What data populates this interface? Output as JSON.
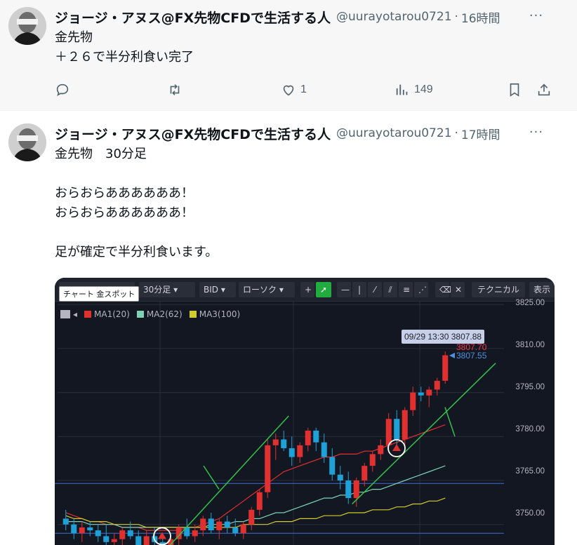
{
  "tweets": [
    {
      "author_name": "ジョージ・アヌス@FX先物CFDで生活する人",
      "handle": "@uurayotarou0721",
      "separator": "·",
      "time": "16時間",
      "more": "···",
      "text": "金先物\n＋２６で半分利食い完了",
      "actions": {
        "reply_count": "",
        "retweet_count": "",
        "like_count": "1",
        "view_count": "149"
      }
    },
    {
      "author_name": "ジョージ・アヌス@FX先物CFDで生活する人",
      "handle": "@uurayotarou0721",
      "separator": "·",
      "time": "17時間",
      "more": "···",
      "text": "金先物　30分足\n\nおらおらああああああ！\nおらおらああああああ！\n\n足が確定で半分利食います。"
    }
  ],
  "chart": {
    "tooltip": "チャート 金スポット",
    "toolbar": {
      "timeframe": "30分足",
      "price_type": "BID",
      "chart_style": "ローソク",
      "technical": "テクニカル",
      "display": "表示"
    },
    "legend": [
      {
        "label": "MA1(20)",
        "color": "#e0302f"
      },
      {
        "label": "MA2(62)",
        "color": "#7fd3b4"
      },
      {
        "label": "MA3(100)",
        "color": "#d3cb2e"
      }
    ],
    "price_labels": [
      "3825.00",
      "3810.00",
      "3795.00",
      "3780.00",
      "3765.00",
      "3750.00"
    ],
    "crosshair_tooltip": "09/29 13:30 3807.88",
    "current_price_red": "3807.70",
    "current_price_blue": "3807.55"
  },
  "chart_data": {
    "type": "candlestick",
    "title": "",
    "ylim": [
      3743,
      3826
    ],
    "y_ticks": [
      3825.0,
      3810.0,
      3795.0,
      3780.0,
      3765.0,
      3750.0
    ],
    "candles": [
      {
        "o": 3752,
        "h": 3755,
        "l": 3748,
        "c": 3750
      },
      {
        "o": 3750,
        "h": 3752,
        "l": 3745,
        "c": 3747
      },
      {
        "o": 3747,
        "h": 3751,
        "l": 3744,
        "c": 3749
      },
      {
        "o": 3749,
        "h": 3751,
        "l": 3746,
        "c": 3748
      },
      {
        "o": 3748,
        "h": 3750,
        "l": 3744,
        "c": 3746
      },
      {
        "o": 3746,
        "h": 3750,
        "l": 3743,
        "c": 3744
      },
      {
        "o": 3744,
        "h": 3747,
        "l": 3742,
        "c": 3745
      },
      {
        "o": 3745,
        "h": 3749,
        "l": 3743,
        "c": 3748
      },
      {
        "o": 3748,
        "h": 3751,
        "l": 3745,
        "c": 3746
      },
      {
        "o": 3746,
        "h": 3748,
        "l": 3741,
        "c": 3743
      },
      {
        "o": 3743,
        "h": 3748,
        "l": 3740,
        "c": 3746
      },
      {
        "o": 3746,
        "h": 3749,
        "l": 3742,
        "c": 3744
      },
      {
        "o": 3744,
        "h": 3746,
        "l": 3740,
        "c": 3742
      },
      {
        "o": 3742,
        "h": 3746,
        "l": 3740,
        "c": 3745
      },
      {
        "o": 3745,
        "h": 3750,
        "l": 3743,
        "c": 3749
      },
      {
        "o": 3749,
        "h": 3752,
        "l": 3745,
        "c": 3746
      },
      {
        "o": 3746,
        "h": 3750,
        "l": 3744,
        "c": 3748
      },
      {
        "o": 3748,
        "h": 3753,
        "l": 3746,
        "c": 3752
      },
      {
        "o": 3752,
        "h": 3754,
        "l": 3747,
        "c": 3748
      },
      {
        "o": 3748,
        "h": 3752,
        "l": 3745,
        "c": 3751
      },
      {
        "o": 3751,
        "h": 3753,
        "l": 3747,
        "c": 3749
      },
      {
        "o": 3749,
        "h": 3752,
        "l": 3746,
        "c": 3747
      },
      {
        "o": 3747,
        "h": 3751,
        "l": 3745,
        "c": 3750
      },
      {
        "o": 3750,
        "h": 3756,
        "l": 3748,
        "c": 3755
      },
      {
        "o": 3755,
        "h": 3762,
        "l": 3753,
        "c": 3761
      },
      {
        "o": 3761,
        "h": 3779,
        "l": 3759,
        "c": 3777
      },
      {
        "o": 3777,
        "h": 3781,
        "l": 3772,
        "c": 3779
      },
      {
        "o": 3779,
        "h": 3782,
        "l": 3775,
        "c": 3776
      },
      {
        "o": 3776,
        "h": 3780,
        "l": 3770,
        "c": 3773
      },
      {
        "o": 3773,
        "h": 3778,
        "l": 3771,
        "c": 3777
      },
      {
        "o": 3777,
        "h": 3783,
        "l": 3775,
        "c": 3782
      },
      {
        "o": 3782,
        "h": 3783,
        "l": 3775,
        "c": 3778
      },
      {
        "o": 3778,
        "h": 3781,
        "l": 3771,
        "c": 3773
      },
      {
        "o": 3773,
        "h": 3776,
        "l": 3765,
        "c": 3767
      },
      {
        "o": 3767,
        "h": 3770,
        "l": 3762,
        "c": 3765
      },
      {
        "o": 3765,
        "h": 3768,
        "l": 3757,
        "c": 3759
      },
      {
        "o": 3759,
        "h": 3766,
        "l": 3756,
        "c": 3765
      },
      {
        "o": 3765,
        "h": 3771,
        "l": 3763,
        "c": 3770
      },
      {
        "o": 3770,
        "h": 3775,
        "l": 3768,
        "c": 3774
      },
      {
        "o": 3774,
        "h": 3779,
        "l": 3772,
        "c": 3777
      },
      {
        "o": 3777,
        "h": 3788,
        "l": 3775,
        "c": 3786
      },
      {
        "o": 3786,
        "h": 3789,
        "l": 3777,
        "c": 3779
      },
      {
        "o": 3779,
        "h": 3790,
        "l": 3776,
        "c": 3789
      },
      {
        "o": 3789,
        "h": 3797,
        "l": 3787,
        "c": 3795
      },
      {
        "o": 3795,
        "h": 3797,
        "l": 3792,
        "c": 3794
      },
      {
        "o": 3794,
        "h": 3797,
        "l": 3790,
        "c": 3796
      },
      {
        "o": 3796,
        "h": 3800,
        "l": 3794,
        "c": 3799
      },
      {
        "o": 3799,
        "h": 3809,
        "l": 3798,
        "c": 3807.7
      }
    ],
    "series": [
      {
        "name": "MA1(20)",
        "color": "#e0302f",
        "values": [
          3754,
          3753,
          3752,
          3751,
          3751,
          3750,
          3750,
          3749,
          3749,
          3749,
          3748,
          3748,
          3748,
          3748,
          3748,
          3749,
          3749,
          3750,
          3751,
          3752,
          3754,
          3756,
          3758,
          3760,
          3762,
          3764,
          3766,
          3768,
          3769,
          3770,
          3771,
          3772,
          3773,
          3773,
          3774,
          3774,
          3774,
          3775,
          3775,
          3776,
          3777,
          3778,
          3779,
          3780,
          3781,
          3782,
          3783,
          3784
        ]
      },
      {
        "name": "MA2(62)",
        "color": "#7fd3b4",
        "values": [
          3751,
          3751,
          3751,
          3750,
          3750,
          3750,
          3750,
          3749,
          3749,
          3749,
          3749,
          3749,
          3749,
          3749,
          3749,
          3749,
          3749,
          3749,
          3750,
          3750,
          3750,
          3751,
          3751,
          3752,
          3752,
          3753,
          3754,
          3754,
          3755,
          3756,
          3757,
          3758,
          3759,
          3759,
          3760,
          3760,
          3761,
          3761,
          3762,
          3762,
          3763,
          3764,
          3765,
          3766,
          3767,
          3768,
          3769,
          3770
        ]
      },
      {
        "name": "MA3(100)",
        "color": "#d3cb2e",
        "values": [
          3753,
          3752,
          3752,
          3751,
          3751,
          3751,
          3750,
          3750,
          3750,
          3750,
          3749,
          3749,
          3749,
          3749,
          3749,
          3749,
          3749,
          3749,
          3749,
          3749,
          3749,
          3749,
          3750,
          3750,
          3750,
          3750,
          3751,
          3751,
          3751,
          3752,
          3752,
          3752,
          3753,
          3753,
          3753,
          3754,
          3754,
          3754,
          3755,
          3755,
          3755,
          3756,
          3756,
          3757,
          3757,
          3758,
          3758,
          3759
        ]
      }
    ]
  }
}
